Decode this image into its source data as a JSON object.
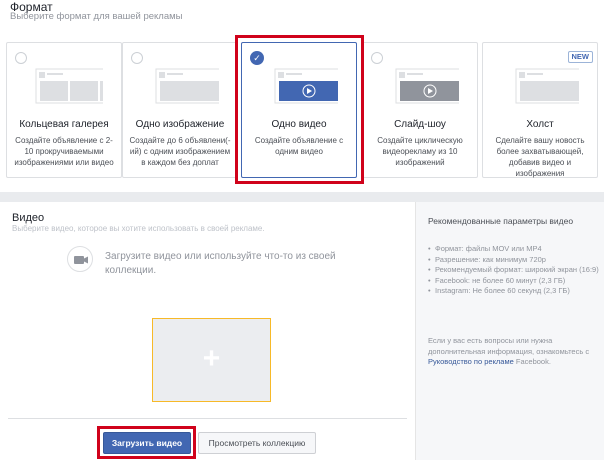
{
  "format": {
    "title": "Формат",
    "subtitle": "Выберите формат для вашей рекламы",
    "cards": [
      {
        "name": "Кольцевая галерея",
        "desc": "Создайте объявление с 2-10 прокручиваемыми изображениями или видео",
        "selected": false,
        "badge": ""
      },
      {
        "name": "Одно изображение",
        "desc": "Создайте до 6 объявлени(-ий) с одним изображением в каждом без доплат",
        "selected": false,
        "badge": ""
      },
      {
        "name": "Одно видео",
        "desc": "Создайте объявление с одним видео",
        "selected": true,
        "badge": ""
      },
      {
        "name": "Слайд-шоу",
        "desc": "Создайте циклическую видеорекламу из 10 изображений",
        "selected": false,
        "badge": ""
      },
      {
        "name": "Холст",
        "desc": "Сделайте вашу новость более захватывающей, добавив видео и изображения",
        "selected": false,
        "badge": "NEW"
      }
    ]
  },
  "video": {
    "title": "Видео",
    "subtitle": "Выберите видео, которое вы хотите использовать в своей рекламе.",
    "prompt": "Загрузите видео или используйте что-то из своей коллекции.",
    "upload_button": "Загрузить видео",
    "browse_button": "Просмотреть коллекцию"
  },
  "recommendations": {
    "title": "Рекомендованные параметры видео",
    "items": [
      "Формат: файлы MOV или MP4",
      "Разрешение: как минимум 720p",
      "Рекомендуемый формат: широкий экран (16:9)",
      "Facebook: не более 60 минут (2,3 ГБ)",
      "Instagram: Не более 60 секунд (2,3 ГБ)"
    ],
    "note_before": "Если у вас есть вопросы или нужна дополнительная информация, ознакомьтесь с ",
    "note_link": "Руководство по рекламе",
    "note_after": " Facebook."
  },
  "colors": {
    "accent": "#4267b2",
    "highlight": "#d0021b",
    "upload_border": "#f7b928"
  }
}
